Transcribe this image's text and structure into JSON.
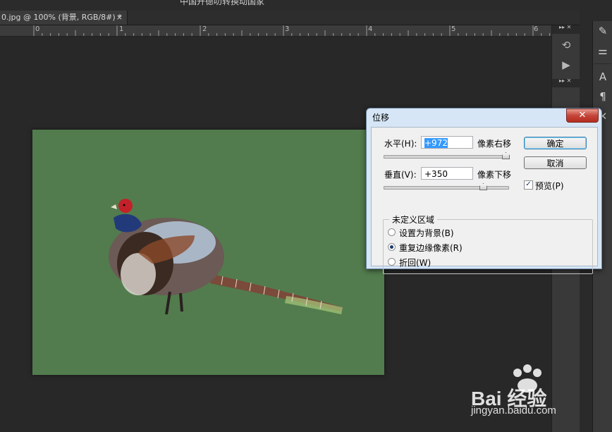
{
  "app": {
    "top_title": "中国开德叻转换动国家",
    "doc_tab": "0.jpg @ 100% (背景, RGB/8#) *",
    "doc_tab_close": "×"
  },
  "ruler": {
    "labels": [
      "0",
      "1",
      "2",
      "3",
      "4",
      "5",
      "6"
    ]
  },
  "panels": {
    "head1": "▸▸ ✕",
    "head2": "▸▸ ✕",
    "icons": [
      "rotate-icon",
      "play-icon",
      "brush-icon",
      "type-icon",
      "paragraph-icon"
    ]
  },
  "dialog": {
    "title": "位移",
    "close": "✕",
    "horizontal_label": "水平(H):",
    "horizontal_value": "+972",
    "horizontal_unit": "像素右移",
    "vertical_label": "垂直(V):",
    "vertical_value": "+350",
    "vertical_unit": "像素下移",
    "ok_label": "确定",
    "cancel_label": "取消",
    "preview_label": "预览(P)",
    "preview_checked": true,
    "group_title": "未定义区域",
    "options": [
      {
        "label": "设置为背景(B)",
        "selected": false
      },
      {
        "label": "重复边缘像素(R)",
        "selected": true
      },
      {
        "label": "折回(W)",
        "selected": false
      }
    ]
  },
  "watermark": {
    "brand": "Bai 经验",
    "url": "jingyan.baidu.com"
  }
}
